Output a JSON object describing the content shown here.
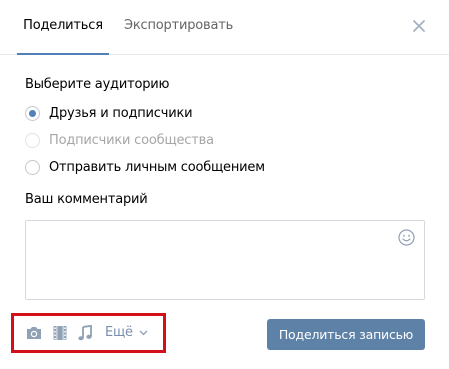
{
  "tabs": [
    {
      "label": "Поделиться",
      "active": true
    },
    {
      "label": "Экспортировать",
      "active": false
    }
  ],
  "audience": {
    "title": "Выберите аудиторию",
    "options": [
      {
        "label": "Друзья и подписчики",
        "selected": true,
        "disabled": false
      },
      {
        "label": "Подписчики сообщества",
        "selected": false,
        "disabled": true
      },
      {
        "label": "Отправить личным сообщением",
        "selected": false,
        "disabled": false
      }
    ]
  },
  "comment": {
    "title": "Ваш комментарий",
    "value": "",
    "emoji_icon": "smile-icon"
  },
  "attachments": {
    "icons": [
      "camera-icon",
      "video-icon",
      "music-icon"
    ],
    "more_label": "Ещё"
  },
  "actions": {
    "share_label": "Поделиться записью"
  },
  "colors": {
    "accent": "#5181b8",
    "button": "#5e81a8",
    "highlight": "#d3101a"
  }
}
